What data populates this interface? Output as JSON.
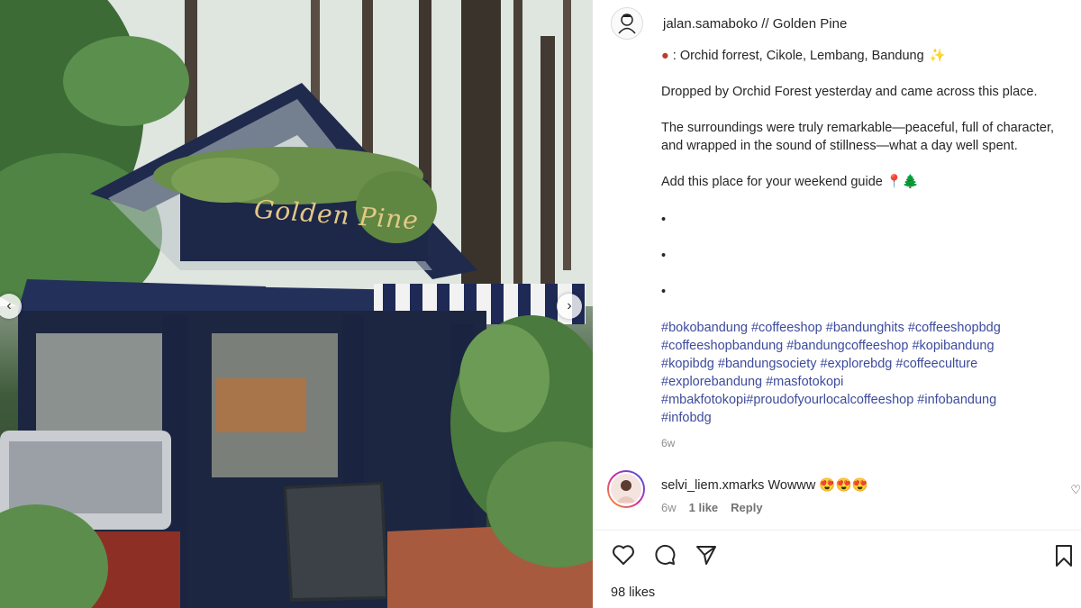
{
  "post": {
    "username": "jalan.samaboko",
    "header_suffix": " // Golden Pine",
    "location_line": ": Orchid forrest, Cikole, Lembang, Bandung",
    "sign_text": "Golden Pine",
    "caption_line1": "Dropped by Orchid Forest yesterday and came across this place.",
    "caption_line2": "The surroundings were truly remarkable—peaceful, full of character,",
    "caption_line3": "and wrapped in the sound of stillness—what a day well spent.",
    "caption_line4": "Add this place for your weekend guide 📍🌲",
    "bullets": [
      "•",
      "•",
      "•"
    ],
    "hashtag_lines": [
      "#bokobandung #coffeeshop #bandunghits #coffeeshopbdg",
      "#coffeeshopbandung #bandungcoffeeshop #kopibandung",
      "#kopibdg #bandungsociety #explorebdg #coffeeculture",
      "#explorebandung #masfotokopi",
      "#mbakfotokopi#proudofyourlocalcoffeeshop #infobandung",
      "#infobdg"
    ],
    "time": "6w"
  },
  "comment": {
    "username": "selvi_liem.xmarks",
    "text": " Wowww ",
    "emojis": "😍😍😍",
    "time": "6w",
    "likes": "1 like",
    "reply": "Reply"
  },
  "footer": {
    "likes": "98 likes"
  },
  "icons": {
    "like": "heart-icon",
    "comment": "comment-icon",
    "share": "send-icon",
    "save": "bookmark-icon",
    "prev": "chevron-left-icon",
    "next": "chevron-right-icon"
  },
  "colors": {
    "hashtag": "#3d4b9c",
    "meta": "#8e8e8e",
    "kiosk_navy": "#1f2a4d",
    "sign_gold": "#e3c886"
  }
}
